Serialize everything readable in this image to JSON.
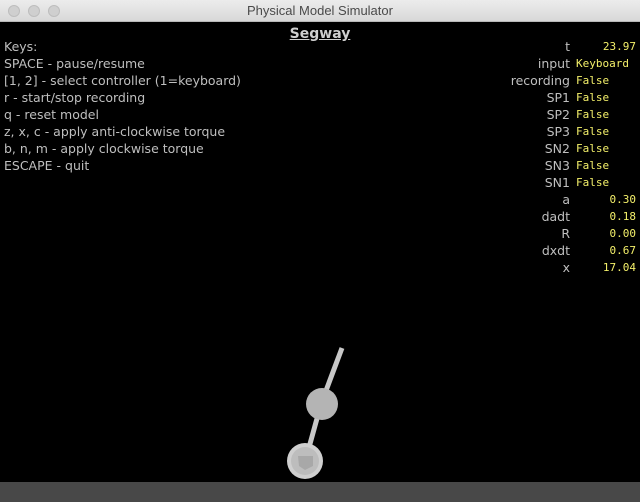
{
  "window": {
    "title": "Physical Model Simulator"
  },
  "sim": {
    "title": "Segway"
  },
  "keys": [
    "Keys:",
    "SPACE - pause/resume",
    "[1, 2] - select controller (1=keyboard)",
    "r - start/stop recording",
    "q - reset model",
    "z, x, c - apply anti-clockwise torque",
    "b, n, m - apply clockwise torque",
    "ESCAPE - quit"
  ],
  "vars": [
    {
      "label": "t",
      "value": "23.97"
    },
    {
      "label": "input",
      "value": "Keyboard"
    },
    {
      "label": "recording",
      "value": "False"
    },
    {
      "label": "SP1",
      "value": "False"
    },
    {
      "label": "SP2",
      "value": "False"
    },
    {
      "label": "SP3",
      "value": "False"
    },
    {
      "label": "SN2",
      "value": "False"
    },
    {
      "label": "SN3",
      "value": "False"
    },
    {
      "label": "SN1",
      "value": "False"
    },
    {
      "label": "a",
      "value": "0.30"
    },
    {
      "label": "dadt",
      "value": "0.18"
    },
    {
      "label": "R",
      "value": "0.00"
    },
    {
      "label": "dxdt",
      "value": "0.67"
    },
    {
      "label": "x",
      "value": "17.04"
    }
  ],
  "colors": {
    "background": "#000000",
    "text": "#bfbfbf",
    "value": "#f3ef6a",
    "model": "#c8c8c8",
    "ground": "#484848"
  }
}
